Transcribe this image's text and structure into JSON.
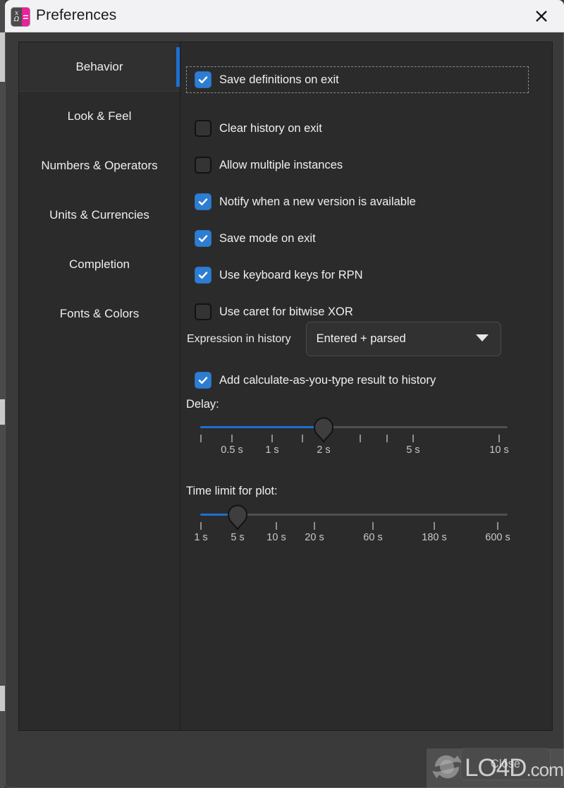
{
  "window": {
    "title": "Preferences",
    "icon_name": "qalculate-app-icon",
    "icon_glyph_top": "x",
    "icon_glyph_bottom": "Ω",
    "icon_glyph_right": "=",
    "close_label": "✕",
    "accent_color": "#1f6fd0",
    "checkbox_color": "#2d7dd2",
    "icon_accent_color": "#ec1f9c",
    "titlebar_bg": "#f2f2f5",
    "panel_bg": "#2b2b2b"
  },
  "sidebar": {
    "items": [
      {
        "label": "Behavior",
        "selected": true
      },
      {
        "label": "Look & Feel",
        "selected": false
      },
      {
        "label": "Numbers & Operators",
        "selected": false
      },
      {
        "label": "Units & Currencies",
        "selected": false
      },
      {
        "label": "Completion",
        "selected": false
      },
      {
        "label": "Fonts & Colors",
        "selected": false
      }
    ]
  },
  "content": {
    "checkboxes": [
      {
        "label": "Save definitions on exit",
        "checked": true,
        "focused": true
      },
      {
        "label": "Clear history on exit",
        "checked": false,
        "focused": false
      },
      {
        "label": "Allow multiple instances",
        "checked": false,
        "focused": false
      },
      {
        "label": "Notify when a new version is available",
        "checked": true,
        "focused": false
      },
      {
        "label": "Save mode on exit",
        "checked": true,
        "focused": false
      },
      {
        "label": "Use keyboard keys for RPN",
        "checked": true,
        "focused": false
      },
      {
        "label": "Use caret for bitwise XOR",
        "checked": false,
        "focused": false
      }
    ],
    "expression_history": {
      "label": "Expression in history",
      "value": "Entered + parsed"
    },
    "catt_checkbox": {
      "label": "Add calculate-as-you-type result to history",
      "checked": true
    },
    "delay_slider": {
      "title": "Delay:",
      "value": "2 s",
      "tick_labels": [
        "0.5 s",
        "1 s",
        "2 s",
        "5 s",
        "10 s"
      ]
    },
    "plot_slider": {
      "title": "Time limit for plot:",
      "value": "5 s",
      "tick_labels": [
        "1 s",
        "5 s",
        "10 s",
        "20 s",
        "60 s",
        "180 s",
        "600 s"
      ]
    }
  },
  "footer": {
    "close_button": "Close"
  },
  "watermark": {
    "brand": "LO4D",
    "suffix": ".com"
  }
}
